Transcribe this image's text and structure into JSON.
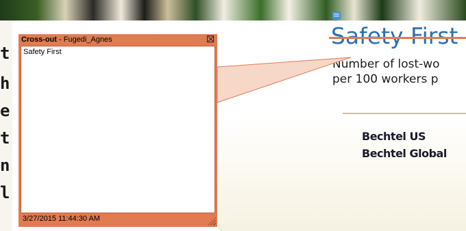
{
  "background": {
    "left_page_glyphs": [
      "t",
      "h",
      "e",
      "t",
      "n",
      "l"
    ],
    "slide": {
      "title": "Safety First",
      "subtitle_line1": "Number of lost-wo",
      "subtitle_line2": "per 100 workers p",
      "legend": [
        "Bechtel US",
        "Bechtel Global"
      ],
      "title_color": "#2a6fb5"
    }
  },
  "annotation_popup": {
    "type_label": "Cross-out",
    "separator": " - ",
    "author": "Fugedi_Agnes",
    "content": "Safety First",
    "timestamp": "3/27/2015 11:44:30 AM",
    "color": "#e07b52",
    "close_icon": "close-box-icon"
  },
  "comment_marker_icon": "comment-icon"
}
